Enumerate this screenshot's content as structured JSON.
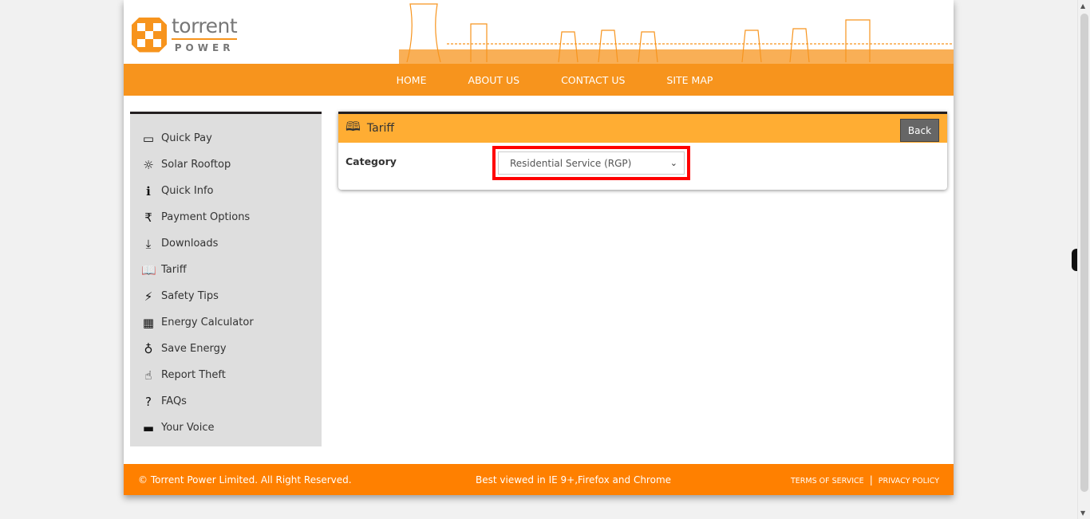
{
  "logo": {
    "brand": "torrent",
    "sub": "POWER"
  },
  "nav": [
    "HOME",
    "ABOUT US",
    "CONTACT US",
    "SITE MAP"
  ],
  "sidebar": {
    "items": [
      {
        "label": "Quick Pay",
        "icon": "credit-card-icon",
        "glyph": "▭"
      },
      {
        "label": "Solar Rooftop",
        "icon": "sun-icon",
        "glyph": "☼"
      },
      {
        "label": "Quick Info",
        "icon": "info-icon",
        "glyph": "ℹ"
      },
      {
        "label": "Payment Options",
        "icon": "rupee-icon",
        "glyph": "₹"
      },
      {
        "label": "Downloads",
        "icon": "download-icon",
        "glyph": "⤓"
      },
      {
        "label": "Tariff",
        "icon": "book-icon",
        "glyph": "📖"
      },
      {
        "label": "Safety Tips",
        "icon": "magic-wand-icon",
        "glyph": "⚡"
      },
      {
        "label": "Energy Calculator",
        "icon": "table-icon",
        "glyph": "▦"
      },
      {
        "label": "Save Energy",
        "icon": "lightbulb-icon",
        "glyph": "♁"
      },
      {
        "label": "Report Theft",
        "icon": "hand-pointer-icon",
        "glyph": "☝"
      },
      {
        "label": "FAQs",
        "icon": "question-icon",
        "glyph": "?"
      },
      {
        "label": "Your Voice",
        "icon": "comment-icon",
        "glyph": "▬"
      }
    ]
  },
  "panel": {
    "title": "Tariff",
    "back": "Back",
    "category_label": "Category",
    "category_value": "Residential Service (RGP)"
  },
  "footer": {
    "copyright": "© Torrent Power Limited. All Right Reserved.",
    "best_viewed": "Best viewed in IE 9+,Firefox and Chrome",
    "terms": "TERMS OF SERVICE",
    "separator": "|",
    "privacy": "PRIVACY POLICY"
  },
  "colors": {
    "nav": "#f7941d",
    "panel_header": "#ffad33",
    "footer": "#ff8000",
    "highlight": "#ff0000"
  }
}
